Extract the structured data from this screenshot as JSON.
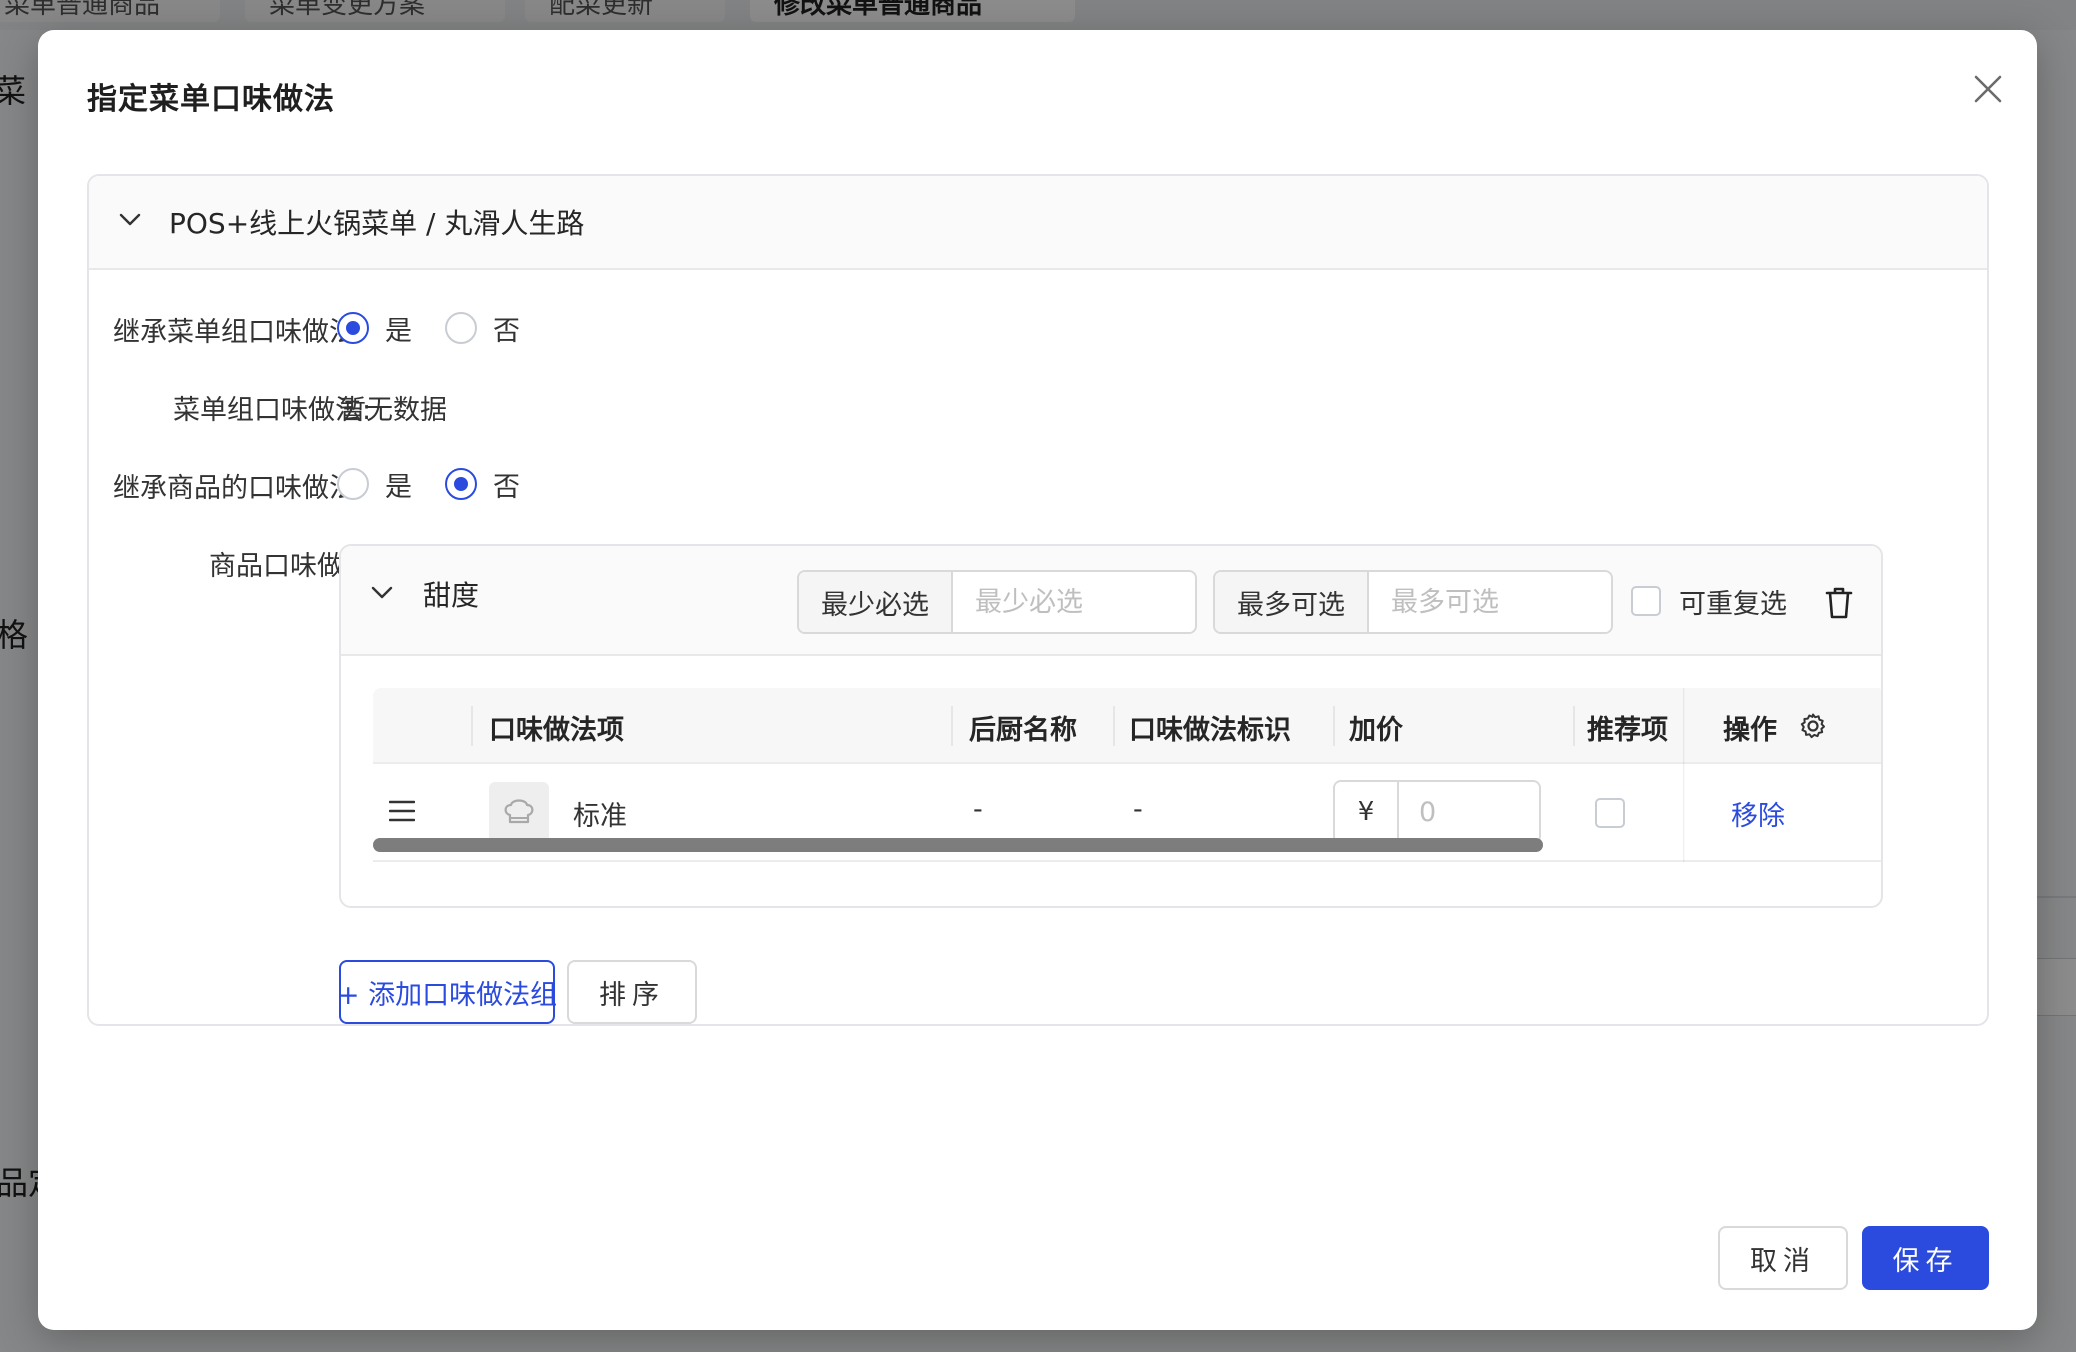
{
  "background": {
    "tabs": [
      {
        "label": "菜单普通商品"
      },
      {
        "label": "菜单变更方案"
      },
      {
        "label": "配菜更新"
      },
      {
        "label": "修改菜单普通商品",
        "active": true
      }
    ],
    "side_fragments": [
      "菜",
      "格",
      "品定"
    ]
  },
  "modal": {
    "title": "指定菜单口味做法",
    "section": {
      "title": "POS+线上火锅菜单 / 丸滑人生路",
      "inherit_group": {
        "label": "继承菜单组口味做法:",
        "options": [
          "是",
          "否"
        ],
        "selected": "是"
      },
      "group_practice": {
        "label": "菜单组口味做法:",
        "value": "暂无数据"
      },
      "inherit_product": {
        "label": "继承商品的口味做法:",
        "options": [
          "是",
          "否"
        ],
        "selected": "否"
      },
      "product_practice": {
        "label": "商品口味做法:",
        "group": {
          "name": "甜度",
          "min_addon": "最少必选",
          "min_placeholder": "最少必选",
          "max_addon": "最多可选",
          "max_placeholder": "最多可选",
          "repeatable_label": "可重复选",
          "table": {
            "columns": [
              "口味做法项",
              "后厨名称",
              "口味做法标识",
              "加价",
              "推荐项",
              "操作"
            ],
            "rows": [
              {
                "name": "标准",
                "kitchen_name": "-",
                "identifier": "-",
                "currency": "¥",
                "price_placeholder": "0",
                "action": "移除"
              }
            ]
          }
        }
      },
      "add_group_label": "+ 添加口味做法组",
      "sort_label": "排序"
    },
    "footer": {
      "cancel_label": "取消",
      "save_label": "保存"
    }
  },
  "colors": {
    "primary": "#2b4bdf",
    "overlay": "rgba(0,0,0,0.45)"
  }
}
